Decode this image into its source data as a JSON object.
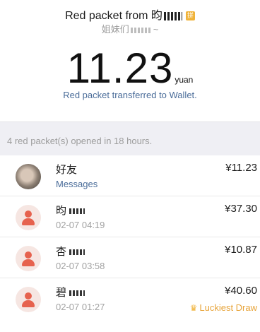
{
  "header": {
    "title_prefix": "Red packet from 昀",
    "title_suffix": "",
    "wish_prefix": "姐妹们",
    "wish_suffix": "~",
    "amount": "11.23",
    "unit": "yuan",
    "transfer_link": "Red packet transferred to Wallet."
  },
  "summary": "4 red packet(s) opened in 18 hours.",
  "rows": [
    {
      "name": "好友",
      "sub": "Messages",
      "amount": "¥11.23",
      "lucky": ""
    },
    {
      "name": "昀",
      "sub": "02-07 04:19",
      "amount": "¥37.30",
      "lucky": ""
    },
    {
      "name": "杏",
      "sub": "02-07 03:58",
      "amount": "¥10.87",
      "lucky": ""
    },
    {
      "name": "碧",
      "sub": "02-07 01:27",
      "amount": "¥40.60",
      "lucky": "Luckiest Draw"
    }
  ],
  "colors": {
    "link": "#4a6c99",
    "lucky": "#e7a43a",
    "avatar_default": "#e6624e",
    "section_bg": "#efeff4"
  },
  "icons": [
    "cat-photo-avatar",
    "default-user-icon",
    "crown-icon"
  ]
}
